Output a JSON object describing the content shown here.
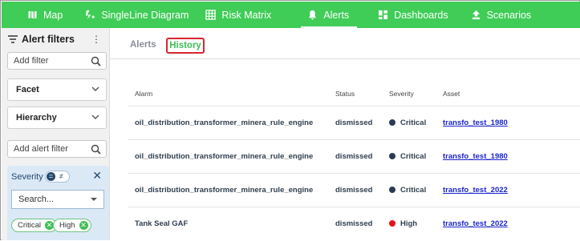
{
  "nav": {
    "items": [
      {
        "label": "Map",
        "icon": "map-icon"
      },
      {
        "label": "SingleLine Diagram",
        "icon": "singleline-icon"
      },
      {
        "label": "Risk Matrix",
        "icon": "grid-icon"
      },
      {
        "label": "Alerts",
        "icon": "bell-icon",
        "active": true
      },
      {
        "label": "Dashboards",
        "icon": "dashboard-icon"
      },
      {
        "label": "Scenarios",
        "icon": "scenarios-icon"
      }
    ],
    "color": "#3fcc57"
  },
  "sidebar": {
    "title": "Alert filters",
    "add_filter_placeholder": "Add filter",
    "facet_label": "Facet",
    "hierarchy_label": "Hierarchy",
    "add_alert_filter_placeholder": "Add alert filter",
    "severity": {
      "label": "Severity",
      "toggle_eq": "=",
      "toggle_neq": "≠",
      "search_placeholder": "Search...",
      "chips": [
        "Critical",
        "High"
      ]
    }
  },
  "tabs": {
    "alerts": "Alerts",
    "history": "History"
  },
  "table": {
    "headers": [
      "Alarm",
      "Status",
      "Severity",
      "Asset"
    ],
    "rows": [
      {
        "alarm": "oil_distribution_transformer_minera_rule_engine",
        "status": "dismissed",
        "severity": "Critical",
        "severity_color": "#2b3a52",
        "asset": "transfo_test_1980"
      },
      {
        "alarm": "oil_distribution_transformer_minera_rule_engine",
        "status": "dismissed",
        "severity": "Critical",
        "severity_color": "#2b3a52",
        "asset": "transfo_test_1980"
      },
      {
        "alarm": "oil_distribution_transformer_minera_rule_engine",
        "status": "dismissed",
        "severity": "Critical",
        "severity_color": "#2b3a52",
        "asset": "transfo_test_2022"
      },
      {
        "alarm": "Tank Seal GAF",
        "status": "dismissed",
        "severity": "High",
        "severity_color": "#e8101a",
        "asset": "transfo_test_2022"
      }
    ]
  }
}
